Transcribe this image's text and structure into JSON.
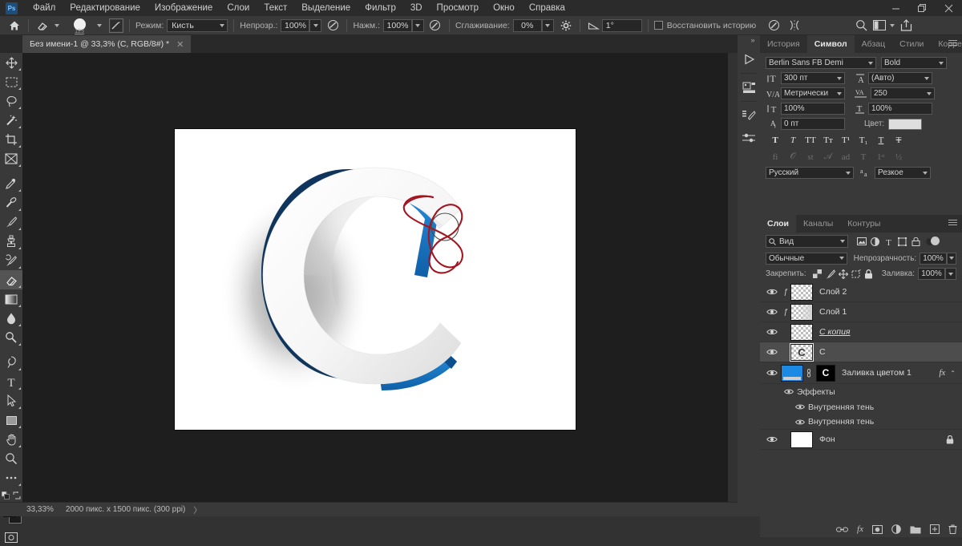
{
  "app": {
    "logo": "Ps"
  },
  "menubar": {
    "items": [
      {
        "label": "Файл",
        "name": "menu-file"
      },
      {
        "label": "Редактирование",
        "name": "menu-edit"
      },
      {
        "label": "Изображение",
        "name": "menu-image"
      },
      {
        "label": "Слои",
        "name": "menu-layers"
      },
      {
        "label": "Текст",
        "name": "menu-type"
      },
      {
        "label": "Выделение",
        "name": "menu-select"
      },
      {
        "label": "Фильтр",
        "name": "menu-filter"
      },
      {
        "label": "3D",
        "name": "menu-3d"
      },
      {
        "label": "Просмотр",
        "name": "menu-view"
      },
      {
        "label": "Окно",
        "name": "menu-window"
      },
      {
        "label": "Справка",
        "name": "menu-help"
      }
    ],
    "window_controls": {
      "minimize": "—",
      "maximize": "❐",
      "close": "✕"
    }
  },
  "optionsbar": {
    "brush_size_badge": "123",
    "mode_label": "Режим:",
    "mode_value": "Кисть",
    "opacity_label": "Непрозр.:",
    "opacity_value": "100%",
    "flow_label": "Нажм.:",
    "flow_value": "100%",
    "smoothing_label": "Сглаживание:",
    "smoothing_value": "0%",
    "angle_value": "1°",
    "restore_history_label": "Восстановить историю"
  },
  "document": {
    "tab_title": "Без имени-1 @ 33,3% (С, RGB/8#) *",
    "close_glyph": "✕"
  },
  "statusbar": {
    "zoom": "33,33%",
    "dimensions": "2000 пикс. x 1500 пикс. (300 ppi)",
    "arrow": "〉"
  },
  "toolbar": {
    "tools": [
      {
        "name": "move-tool",
        "icon": "move"
      },
      {
        "name": "rectangular-marquee-tool",
        "icon": "marquee"
      },
      {
        "name": "lasso-tool",
        "icon": "lasso"
      },
      {
        "name": "magic-wand-tool",
        "icon": "wand"
      },
      {
        "name": "crop-tool",
        "icon": "crop"
      },
      {
        "name": "frame-tool",
        "icon": "frame"
      },
      {
        "name": "eyedropper-tool",
        "icon": "eyedropper"
      },
      {
        "name": "spot-healing-brush-tool",
        "icon": "healing"
      },
      {
        "name": "brush-tool",
        "icon": "brush"
      },
      {
        "name": "clone-stamp-tool",
        "icon": "stamp"
      },
      {
        "name": "history-brush-tool",
        "icon": "historybrush"
      },
      {
        "name": "eraser-tool",
        "icon": "eraser",
        "selected": true
      },
      {
        "name": "gradient-tool",
        "icon": "gradient"
      },
      {
        "name": "blur-tool",
        "icon": "blur"
      },
      {
        "name": "dodge-tool",
        "icon": "dodge"
      },
      {
        "name": "pen-tool",
        "icon": "pen"
      },
      {
        "name": "type-tool",
        "icon": "type"
      },
      {
        "name": "path-selection-tool",
        "icon": "pathselect"
      },
      {
        "name": "rectangle-tool",
        "icon": "rectangle"
      },
      {
        "name": "hand-tool",
        "icon": "hand"
      },
      {
        "name": "zoom-tool",
        "icon": "zoom"
      },
      {
        "name": "edit-toolbar-button",
        "icon": "ellipsis"
      }
    ],
    "foreground_color": "#d8d8d8",
    "background_color": "#1b1b1b"
  },
  "character_panel": {
    "tabs": [
      {
        "label": "История",
        "name": "tab-history",
        "active": false
      },
      {
        "label": "Символ",
        "name": "tab-character",
        "active": true
      },
      {
        "label": "Абзац",
        "name": "tab-paragraph",
        "active": false
      },
      {
        "label": "Стили",
        "name": "tab-styles",
        "active": false
      },
      {
        "label": "Коррекция",
        "name": "tab-adjustments",
        "active": false
      }
    ],
    "font_family": "Berlin Sans FB Demi",
    "font_style": "Bold",
    "font_size": "300 пт",
    "leading": "(Авто)",
    "kerning": "Метрически",
    "tracking": "250",
    "vertical_scale": "100%",
    "horizontal_scale": "100%",
    "baseline_shift": "0 пт",
    "color_label": "Цвет:",
    "color_value": "#dedede",
    "language": "Русский",
    "antialias": "Резкое",
    "style_buttons": [
      "T",
      "T",
      "TT",
      "Tт",
      "T¹",
      "T₁",
      "T",
      "T"
    ],
    "opentype_buttons": [
      "fi",
      "𝒪",
      "st",
      "𝒜",
      "ad",
      "T",
      "1ˢᵗ",
      "½"
    ]
  },
  "layers_panel": {
    "tabs": [
      {
        "label": "Слои",
        "name": "tab-layers",
        "active": true
      },
      {
        "label": "Каналы",
        "name": "tab-channels",
        "active": false
      },
      {
        "label": "Контуры",
        "name": "tab-paths",
        "active": false
      }
    ],
    "filter_label": "Вид",
    "blend_mode": "Обычные",
    "opacity_label": "Непрозрачность:",
    "opacity_value": "100%",
    "lock_label": "Закрепить:",
    "fill_label": "Заливка:",
    "fill_value": "100%",
    "layers": [
      {
        "name": "Слой 2",
        "type": "pixel",
        "thumb": "checker",
        "fx_mark": "ƒ",
        "selected": false,
        "visible": true
      },
      {
        "name": "Слой 1",
        "type": "pixel",
        "thumb": "checker-grad",
        "fx_mark": "ƒ",
        "selected": false,
        "visible": true
      },
      {
        "name": "С копия",
        "type": "pixel",
        "thumb": "checker",
        "italic": true,
        "selected": false,
        "visible": true
      },
      {
        "name": "С",
        "type": "smart",
        "thumb": "checker-c",
        "selected": true,
        "visible": true
      },
      {
        "name": "Заливка цветом 1",
        "type": "fill",
        "thumb": "blue",
        "mask": "C",
        "fx": "fx",
        "chevron": "⌃",
        "selected": false,
        "visible": true
      },
      {
        "name": "Фон",
        "type": "background",
        "thumb": "white",
        "locked": true,
        "selected": false,
        "visible": true
      }
    ],
    "effects_group": "Эффекты",
    "effects": [
      "Внутренняя тень",
      "Внутренняя тень"
    ],
    "bottom_icons": [
      {
        "name": "link-layers-button",
        "glyph": "🔗"
      },
      {
        "name": "layer-style-button",
        "glyph": "fx"
      },
      {
        "name": "layer-mask-button",
        "glyph": "mask"
      },
      {
        "name": "adjustment-layer-button",
        "glyph": "adj"
      },
      {
        "name": "new-group-button",
        "glyph": "folder"
      },
      {
        "name": "new-layer-button",
        "glyph": "plus"
      },
      {
        "name": "delete-layer-button",
        "glyph": "trash"
      }
    ]
  },
  "canvas": {
    "letter": "C",
    "letter_fill": "#f4f4f4",
    "edge_dark_blue": "#123a63",
    "edge_blue": "#1a7fd4",
    "annotation_color": "#a31621",
    "background": "#ffffff"
  }
}
